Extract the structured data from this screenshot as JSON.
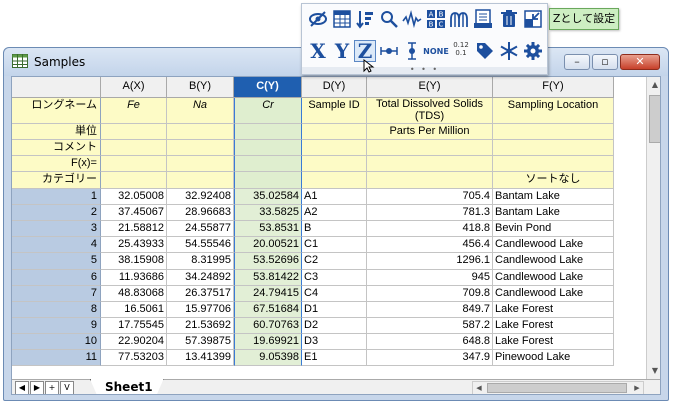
{
  "window": {
    "title": "Samples",
    "minimize_label": "–",
    "maximize_label": "▫",
    "close_label": "✕"
  },
  "tooltip": "Zとして設定",
  "toolbar": {
    "row1_icons": [
      "hide-icon",
      "column-stats-icon",
      "sort-icon",
      "find-icon",
      "signal-icon",
      "data-labels-icon",
      "plot-tree-icon",
      "report-icon",
      "delete-icon",
      "move-icon"
    ],
    "x_label": "X",
    "y_label": "Y",
    "z_label": "Z",
    "none_label": "NONE",
    "format_label": "0.12",
    "format_sub": "0.1",
    "row2_icons": [
      "x-error-icon",
      "y-error-icon",
      "tag-icon",
      "snowflake-icon",
      "gear-icon"
    ]
  },
  "columns": [
    {
      "name": "A(X)",
      "long_name": "Fe",
      "units": "",
      "selected": false
    },
    {
      "name": "B(Y)",
      "long_name": "Na",
      "units": "",
      "selected": false
    },
    {
      "name": "C(Y)",
      "long_name": "Cr",
      "units": "",
      "selected": true
    },
    {
      "name": "D(Y)",
      "long_name": "Sample ID",
      "units": "",
      "selected": false
    },
    {
      "name": "E(Y)",
      "long_name": "Total Dissolved Solids (TDS)",
      "units": "Parts Per Million",
      "selected": false
    },
    {
      "name": "F(Y)",
      "long_name": "Sampling Location",
      "units": "",
      "selected": false
    }
  ],
  "meta_rows": {
    "long_name": "ロングネーム",
    "units": "単位",
    "comments": "コメント",
    "fx": "F(x)=",
    "category": "カテゴリー"
  },
  "category_f": "ソートなし",
  "rows": [
    {
      "n": "1",
      "a": "32.05008",
      "b": "32.92408",
      "c": "35.02584",
      "d": "A1",
      "e": "705.4",
      "f": "Bantam Lake"
    },
    {
      "n": "2",
      "a": "37.45067",
      "b": "28.96683",
      "c": "33.5825",
      "d": "A2",
      "e": "781.3",
      "f": "Bantam Lake"
    },
    {
      "n": "3",
      "a": "21.58812",
      "b": "24.55877",
      "c": "53.8531",
      "d": "B",
      "e": "418.8",
      "f": "Bevin Pond"
    },
    {
      "n": "4",
      "a": "25.43933",
      "b": "54.55546",
      "c": "20.00521",
      "d": "C1",
      "e": "456.4",
      "f": "Candlewood Lake"
    },
    {
      "n": "5",
      "a": "38.15908",
      "b": "8.31995",
      "c": "53.52696",
      "d": "C2",
      "e": "1296.1",
      "f": "Candlewood Lake"
    },
    {
      "n": "6",
      "a": "11.93686",
      "b": "34.24892",
      "c": "53.81422",
      "d": "C3",
      "e": "945",
      "f": "Candlewood Lake"
    },
    {
      "n": "7",
      "a": "48.83068",
      "b": "26.37517",
      "c": "24.79415",
      "d": "C4",
      "e": "709.8",
      "f": "Candlewood Lake"
    },
    {
      "n": "8",
      "a": "16.5061",
      "b": "15.97706",
      "c": "67.51684",
      "d": "D1",
      "e": "849.7",
      "f": "Lake Forest"
    },
    {
      "n": "9",
      "a": "17.75545",
      "b": "21.53692",
      "c": "60.70763",
      "d": "D2",
      "e": "587.2",
      "f": "Lake Forest"
    },
    {
      "n": "10",
      "a": "22.90204",
      "b": "57.39875",
      "c": "19.69921",
      "d": "D3",
      "e": "648.8",
      "f": "Lake Forest"
    },
    {
      "n": "11",
      "a": "77.53203",
      "b": "13.41399",
      "c": "9.05398",
      "d": "E1",
      "e": "347.9",
      "f": "Pinewood Lake"
    }
  ],
  "sheet_tab": "Sheet1",
  "nav": {
    "first": "◀",
    "prev": "▶",
    "add": "+",
    "menu": "V"
  }
}
